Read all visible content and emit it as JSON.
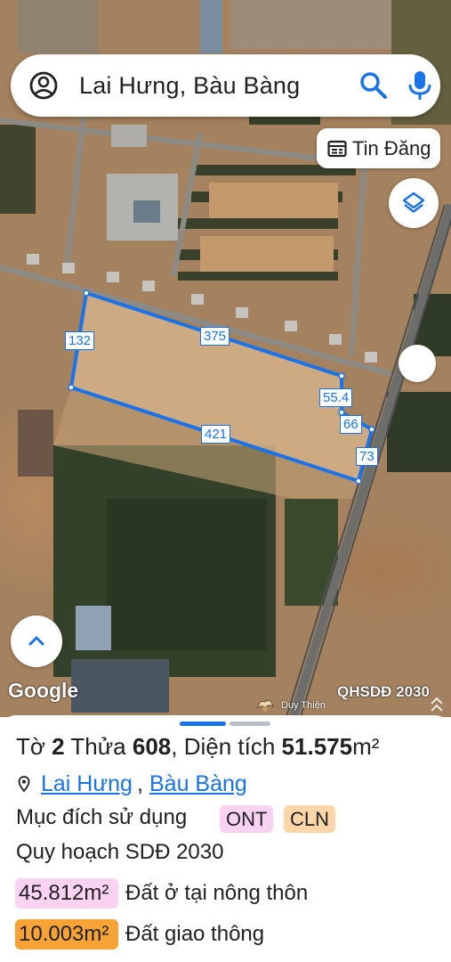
{
  "search": {
    "query": "Lai Hưng, Bàu Bàng",
    "account_icon": "account-circle-icon",
    "search_icon": "search-icon",
    "mic_icon": "mic-icon"
  },
  "map": {
    "tin_dang_label": "Tin Đăng",
    "layer_label": "QHSDĐ 2030",
    "watermark": "Duy Thiện",
    "google_logo": "Google",
    "parcel_edges": {
      "north": "375",
      "west": "132",
      "south": "421",
      "east_upper": "55.4",
      "east_mid": "66",
      "east_lower": "73"
    },
    "parcel_color": "#1a73e8"
  },
  "parcel": {
    "title_prefix": "Tờ",
    "sheet_no": "2",
    "plot_label": "Thửa",
    "plot_no": "608",
    "area_label": "Diện tích",
    "area_value": "51.575",
    "area_unit": "m²",
    "location_1": "Lai Hưng",
    "location_sep": ",",
    "location_2": "Bàu Bàng",
    "purpose_label": "Mục đích sử dụng",
    "purpose_codes": [
      "ONT",
      "CLN"
    ],
    "plan_label": "Quy hoạch SDĐ 2030",
    "plan_rows": [
      {
        "area": "45.812m²",
        "desc": "Đất ở tại nông thôn",
        "color": "#fbd3f2"
      },
      {
        "area": "10.003m²",
        "desc": "Đất giao thông",
        "color": "#f7a335"
      }
    ]
  }
}
